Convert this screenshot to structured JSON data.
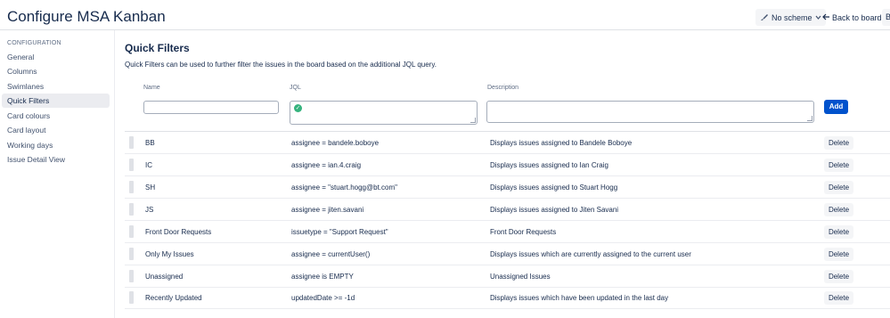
{
  "header": {
    "title": "Configure MSA Kanban",
    "scheme_label": "No scheme",
    "back_label": "Back to board",
    "more_label": "B"
  },
  "sidebar": {
    "heading": "CONFIGURATION",
    "items": [
      {
        "label": "General",
        "active": false
      },
      {
        "label": "Columns",
        "active": false
      },
      {
        "label": "Swimlanes",
        "active": false
      },
      {
        "label": "Quick Filters",
        "active": true
      },
      {
        "label": "Card colours",
        "active": false
      },
      {
        "label": "Card layout",
        "active": false
      },
      {
        "label": "Working days",
        "active": false
      },
      {
        "label": "Issue Detail View",
        "active": false
      }
    ]
  },
  "main": {
    "title": "Quick Filters",
    "description": "Quick Filters can be used to further filter the issues in the board based on the additional JQL query.",
    "columns": {
      "name": "Name",
      "jql": "JQL",
      "description": "Description"
    },
    "add_label": "Add",
    "filters": [
      {
        "name": "BB",
        "jql": "assignee = bandele.boboye",
        "description": "Displays issues assigned to Bandele Boboye"
      },
      {
        "name": "IC",
        "jql": "assignee = ian.4.craig",
        "description": "Displays issues assigned to Ian Craig"
      },
      {
        "name": "SH",
        "jql": "assignee = \"stuart.hogg@bt.com\"",
        "description": "Displays issues assigned to Stuart Hogg"
      },
      {
        "name": "JS",
        "jql": "assignee = jiten.savani",
        "description": "Displays issues assigned to Jiten Savani"
      },
      {
        "name": "Front Door Requests",
        "jql": "issuetype = \"Support Request\"",
        "description": "Front Door Requests"
      },
      {
        "name": "Only My Issues",
        "jql": "assignee = currentUser()",
        "description": "Displays issues which are currently assigned to the current user"
      },
      {
        "name": "Unassigned",
        "jql": "assignee is EMPTY",
        "description": "Unassigned Issues"
      },
      {
        "name": "Recently Updated",
        "jql": "updatedDate >= -1d",
        "description": "Displays issues which have been updated in the last day"
      }
    ],
    "delete_label": "Delete"
  },
  "icons": {
    "scheme": "brush-icon",
    "scheme_chevron": "chevron-down-icon",
    "back": "arrow-left-icon",
    "jql_valid": "check-circle-icon"
  },
  "colors": {
    "accent": "#0052cc",
    "valid": "#36b37e",
    "active_bg": "#ebecf0"
  }
}
